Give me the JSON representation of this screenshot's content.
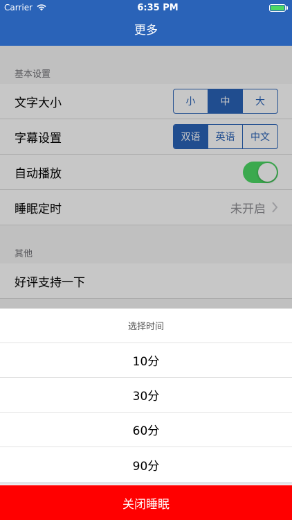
{
  "status": {
    "carrier": "Carrier",
    "time": "6:35 PM"
  },
  "nav": {
    "title": "更多"
  },
  "sections": {
    "basic": {
      "header": "基本设置",
      "font_size": {
        "label": "文字大小",
        "options": [
          "小",
          "中",
          "大"
        ],
        "selected": "中"
      },
      "subtitle": {
        "label": "字幕设置",
        "options": [
          "双语",
          "英语",
          "中文"
        ],
        "selected": "双语"
      },
      "autoplay": {
        "label": "自动播放",
        "on": true
      },
      "sleep_timer": {
        "label": "睡眠定时",
        "value": "未开启"
      }
    },
    "other": {
      "header": "其他",
      "rate": {
        "label": "好评支持一下"
      }
    }
  },
  "sheet": {
    "title": "选择时间",
    "options": [
      "10分",
      "30分",
      "60分",
      "90分"
    ],
    "close": "关闭睡眠"
  },
  "colors": {
    "primary": "#2a63b8",
    "toggle_on": "#4cd964",
    "close": "#ff0000"
  }
}
